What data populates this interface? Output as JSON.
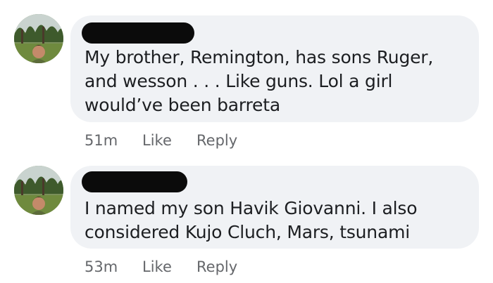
{
  "comments": [
    {
      "author_redacted": true,
      "text": "My brother, Remington, has sons Ruger, and wesson . . . Like guns. Lol a girl would’ve been barreta",
      "time": "51m",
      "like_label": "Like",
      "reply_label": "Reply"
    },
    {
      "author_redacted": true,
      "text": "I named my son Havik Giovanni. I also considered Kujo Cluch, Mars, tsunami",
      "time": "53m",
      "like_label": "Like",
      "reply_label": "Reply"
    }
  ],
  "colors": {
    "bubble": "#f0f2f5",
    "text": "#1c1e21",
    "meta": "#65676b",
    "redaction": "#0b0b0b"
  },
  "icons": {
    "avatar": "profile-photo-avatar"
  }
}
